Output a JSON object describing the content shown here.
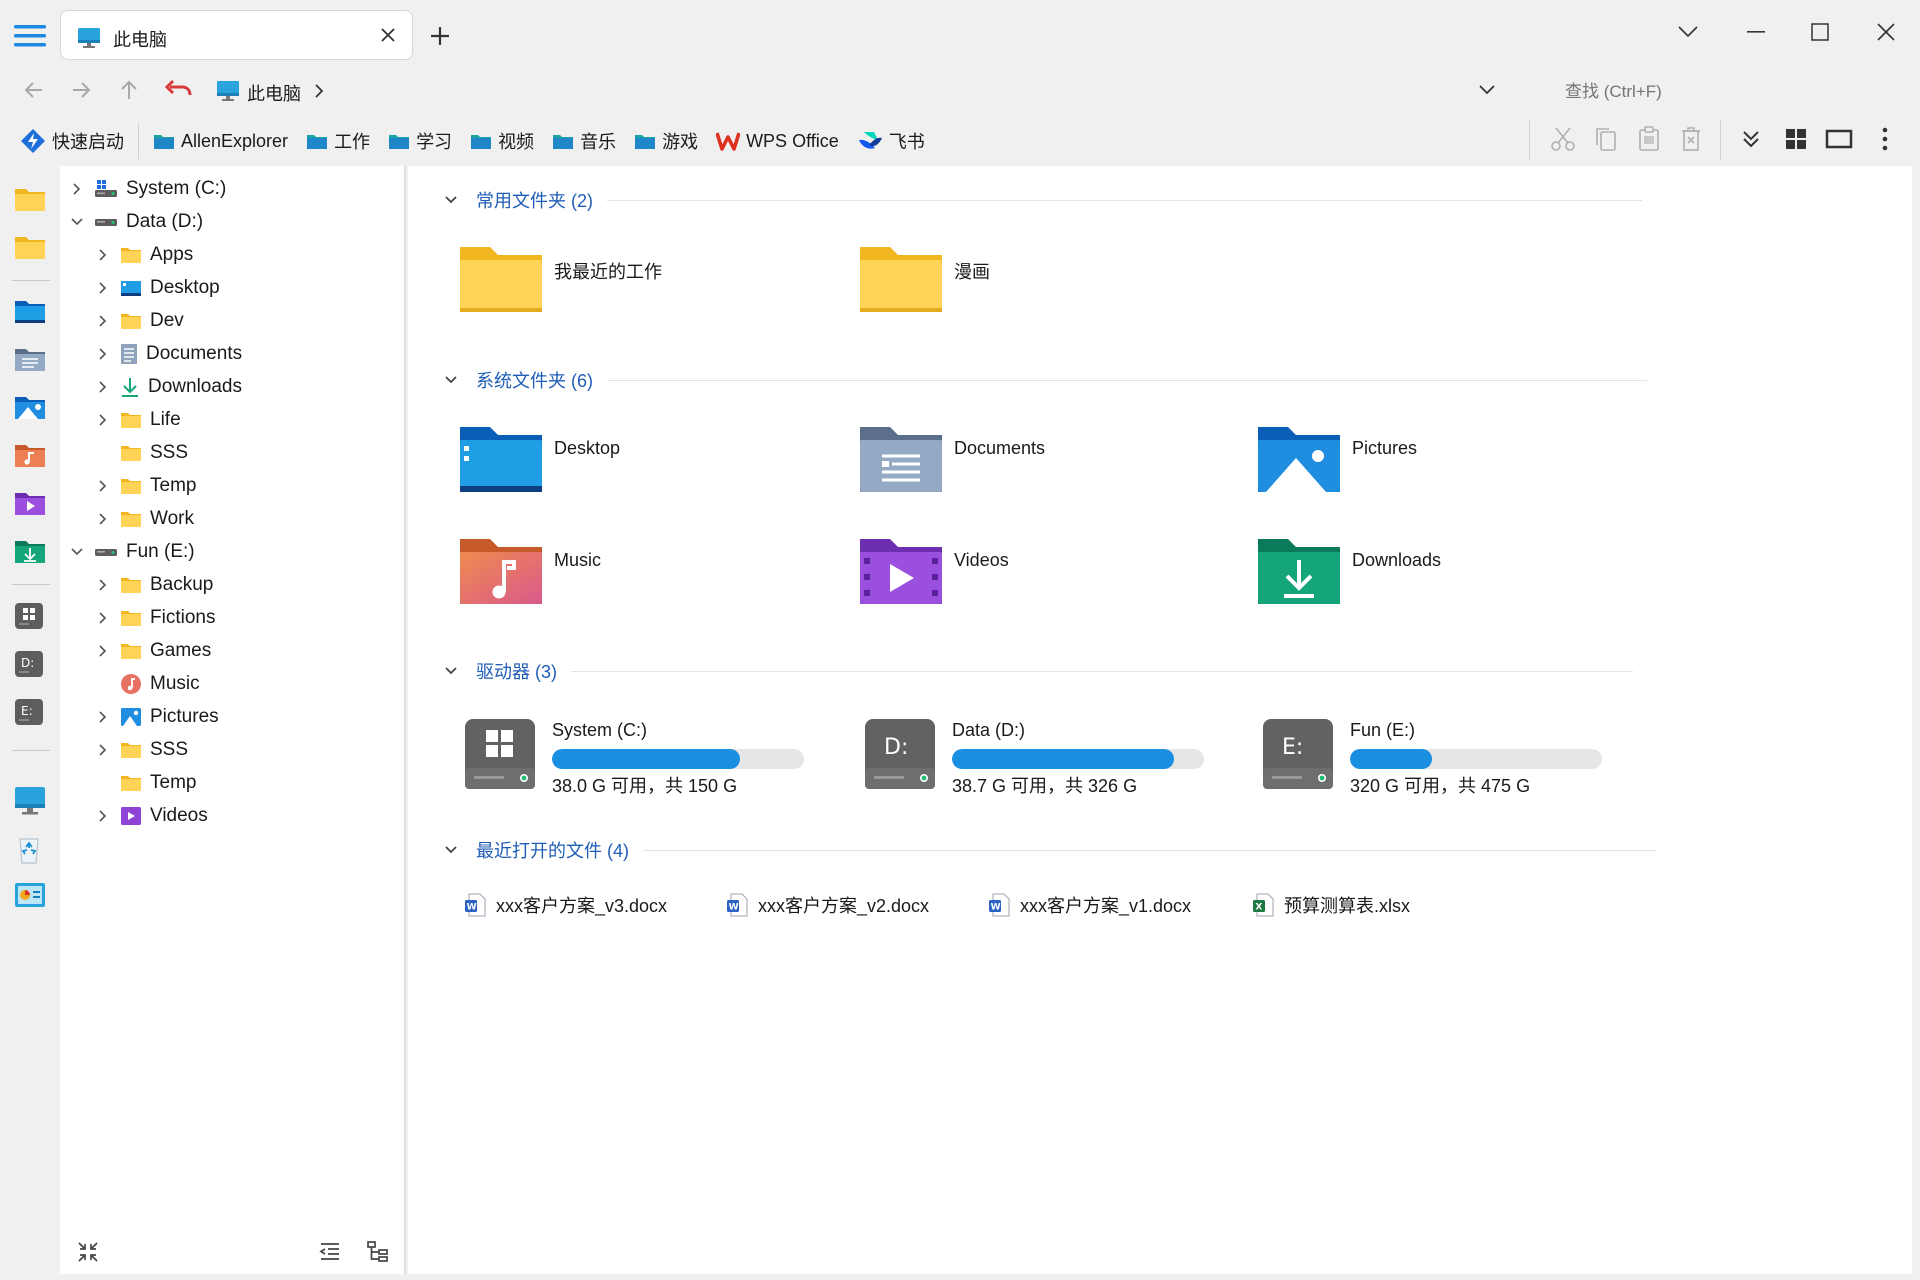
{
  "tab": {
    "title": "此电脑"
  },
  "breadcrumb": {
    "label": "此电脑"
  },
  "search": {
    "placeholder": "查找 (Ctrl+F)"
  },
  "bookmarks": [
    {
      "label": "快速启动",
      "icon": "quick-launch-icon"
    },
    {
      "label": "AllenExplorer",
      "icon": "folder-teal-icon"
    },
    {
      "label": "工作",
      "icon": "folder-teal-icon"
    },
    {
      "label": "学习",
      "icon": "folder-teal-icon"
    },
    {
      "label": "视频",
      "icon": "folder-teal-icon"
    },
    {
      "label": "音乐",
      "icon": "folder-teal-icon"
    },
    {
      "label": "游戏",
      "icon": "folder-teal-icon"
    },
    {
      "label": "WPS Office",
      "icon": "wps-icon"
    },
    {
      "label": "飞书",
      "icon": "feishu-icon"
    }
  ],
  "tree": [
    {
      "label": "System (C:)",
      "level": 0,
      "expanded": false,
      "has_children": true,
      "icon": "drive-c-icon"
    },
    {
      "label": "Data (D:)",
      "level": 0,
      "expanded": true,
      "has_children": true,
      "icon": "drive-icon"
    },
    {
      "label": "Apps",
      "level": 1,
      "has_children": true,
      "icon": "folder-icon"
    },
    {
      "label": "Desktop",
      "level": 1,
      "has_children": true,
      "icon": "desktop-icon"
    },
    {
      "label": "Dev",
      "level": 1,
      "has_children": true,
      "icon": "folder-icon"
    },
    {
      "label": "Documents",
      "level": 1,
      "has_children": true,
      "icon": "documents-icon"
    },
    {
      "label": "Downloads",
      "level": 1,
      "has_children": true,
      "icon": "download-icon"
    },
    {
      "label": "Life",
      "level": 1,
      "has_children": true,
      "icon": "folder-icon"
    },
    {
      "label": "SSS",
      "level": 1,
      "has_children": false,
      "icon": "folder-icon"
    },
    {
      "label": "Temp",
      "level": 1,
      "has_children": true,
      "icon": "folder-icon"
    },
    {
      "label": "Work",
      "level": 1,
      "has_children": true,
      "icon": "folder-icon"
    },
    {
      "label": "Fun (E:)",
      "level": 0,
      "expanded": true,
      "has_children": true,
      "icon": "drive-icon"
    },
    {
      "label": "Backup",
      "level": 1,
      "has_children": true,
      "icon": "folder-icon"
    },
    {
      "label": "Fictions",
      "level": 1,
      "has_children": true,
      "icon": "folder-icon"
    },
    {
      "label": "Games",
      "level": 1,
      "has_children": true,
      "icon": "folder-icon"
    },
    {
      "label": "Music",
      "level": 1,
      "has_children": false,
      "icon": "music-icon"
    },
    {
      "label": "Pictures",
      "level": 1,
      "has_children": true,
      "icon": "pictures-icon"
    },
    {
      "label": "SSS",
      "level": 1,
      "has_children": true,
      "icon": "folder-icon"
    },
    {
      "label": "Temp",
      "level": 1,
      "has_children": false,
      "icon": "folder-icon"
    },
    {
      "label": "Videos",
      "level": 1,
      "has_children": true,
      "icon": "videos-icon"
    }
  ],
  "sections": {
    "favorites": {
      "title": "常用文件夹 (2)",
      "items": [
        "我最近的工作",
        "漫画"
      ]
    },
    "system": {
      "title": "系统文件夹 (6)",
      "items": [
        "Desktop",
        "Documents",
        "Pictures",
        "Music",
        "Videos",
        "Downloads"
      ]
    },
    "drives": {
      "title": "驱动器 (3)",
      "items": [
        {
          "label": "System (C:)",
          "letter": "",
          "info": "38.0 G 可用，共 150 G",
          "used_fraction": 0.747
        },
        {
          "label": "Data (D:)",
          "letter": "D:",
          "info": "38.7 G 可用，共 326 G",
          "used_fraction": 0.881
        },
        {
          "label": "Fun (E:)",
          "letter": "E:",
          "info": "320 G 可用，共 475 G",
          "used_fraction": 0.326
        }
      ]
    },
    "recent": {
      "title": "最近打开的文件 (4)",
      "items": [
        {
          "label": "xxx客户方案_v3.docx",
          "type": "word"
        },
        {
          "label": "xxx客户方案_v2.docx",
          "type": "word"
        },
        {
          "label": "xxx客户方案_v1.docx",
          "type": "word"
        },
        {
          "label": "预算测算表.xlsx",
          "type": "excel"
        }
      ]
    }
  },
  "colors": {
    "accent": "#1a8ee0",
    "section_title": "#1f5db7",
    "undo": "#d83b3b"
  }
}
